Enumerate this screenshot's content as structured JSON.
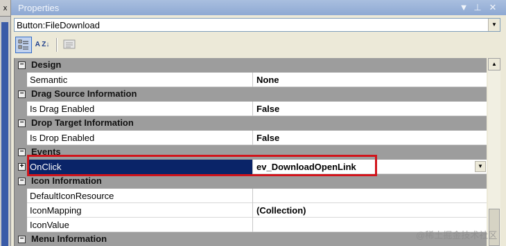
{
  "left_strip": {
    "button_label": "x"
  },
  "panel": {
    "title": "Properties",
    "title_buttons": {
      "dropdown": "▼",
      "pin": "⊥",
      "close": "✕"
    },
    "colors": {
      "title_bg": "#9eb6dc",
      "category_bg": "#9d9d9d",
      "selected_bg": "#0a2468",
      "highlight_border": "#d1141b"
    }
  },
  "object_selector": {
    "value": "Button:FileDownload",
    "dropdown_glyph": "▼"
  },
  "toolbar": {
    "categorized_icon": "categorized-icon",
    "alphabetical_label": "A Z↓",
    "property_pages_icon": "property-pages-icon"
  },
  "grid": {
    "categories": {
      "design": {
        "toggle": "−",
        "label": "Design"
      },
      "drag_source": {
        "toggle": "−",
        "label": "Drag Source Information"
      },
      "drop_target": {
        "toggle": "−",
        "label": "Drop Target Information"
      },
      "events": {
        "toggle": "−",
        "label": "Events"
      },
      "icon_info": {
        "toggle": "−",
        "label": "Icon Information"
      },
      "menu_info": {
        "toggle": "−",
        "label": "Menu Information"
      }
    },
    "properties": {
      "semantic": {
        "name": "Semantic",
        "value": "None"
      },
      "is_drag_enabled": {
        "name": "Is Drag Enabled",
        "value": "False"
      },
      "is_drop_enabled": {
        "name": "Is Drop Enabled",
        "value": "False"
      },
      "onclick": {
        "expand": "+",
        "name": "OnClick",
        "value": "ev_DownloadOpenLink",
        "dropdown_glyph": "▼"
      },
      "default_icon_resource": {
        "name": "DefaultIconResource",
        "value": ""
      },
      "icon_mapping": {
        "name": "IconMapping",
        "value": "(Collection)"
      },
      "icon_value": {
        "name": "IconValue",
        "value": ""
      }
    }
  },
  "scrollbar": {
    "up_glyph": "▲"
  },
  "watermark": "@稀土掘金技术社区"
}
